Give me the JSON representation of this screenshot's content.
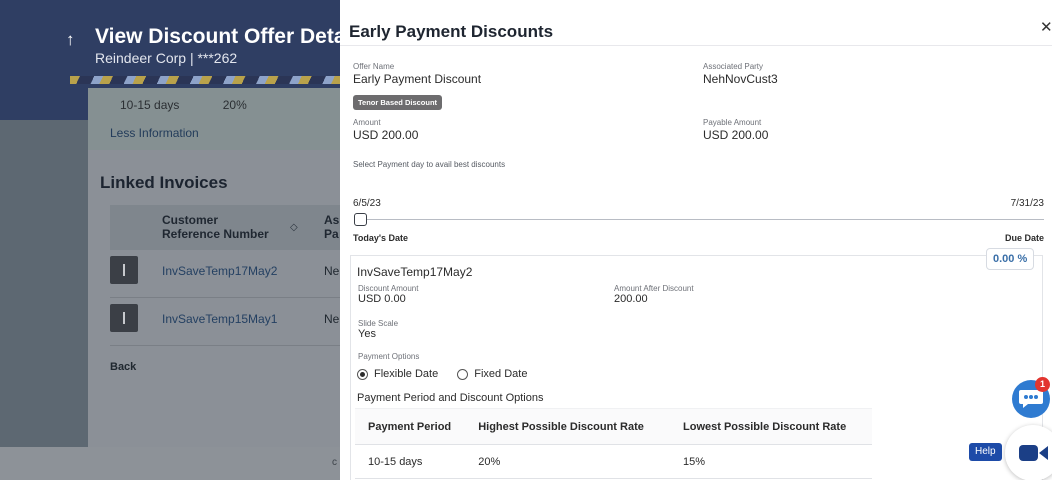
{
  "background": {
    "title": "View Discount Offer Details",
    "subtitle": "Reindeer Corp | ***262",
    "tenor_row": {
      "period": "10-15 days",
      "rate": "20%"
    },
    "less_information": "Less Information",
    "linked_invoices": {
      "title": "Linked Invoices",
      "col_customer_ref": "Customer Reference Number",
      "col_associated_party": "As Pa",
      "rows": [
        {
          "ref": "InvSaveTemp17May2",
          "party": "Ne"
        },
        {
          "ref": "InvSaveTemp15May1",
          "party": "Ne"
        }
      ]
    },
    "back": "Back",
    "footer_fragment": "c"
  },
  "drawer": {
    "title": "Early Payment Discounts",
    "close_icon": "close-icon",
    "offer_name_label": "Offer Name",
    "offer_name": "Early Payment Discount",
    "associated_party_label": "Associated Party",
    "associated_party": "NehNovCust3",
    "badge": "Tenor Based Discount",
    "amount_label": "Amount",
    "amount": "USD 200.00",
    "payable_amount_label": "Payable Amount",
    "payable_amount": "USD 200.00",
    "slider_hint": "Select Payment day to avail best discounts",
    "slider": {
      "start_date": "6/5/23",
      "end_date": "7/31/23",
      "left_label": "Today's Date",
      "right_label": "Due Date",
      "position_fraction": 0.0
    },
    "invoice": {
      "name": "InvSaveTemp17May2",
      "rate": "0.00 %",
      "discount_amount_label": "Discount Amount",
      "discount_amount": "USD 0.00",
      "amount_after_discount_label": "Amount After Discount",
      "amount_after_discount": "200.00",
      "slide_scale_label": "Slide Scale",
      "slide_scale": "Yes",
      "payment_options_label": "Payment Options",
      "options": [
        {
          "label": "Flexible Date",
          "checked": true
        },
        {
          "label": "Fixed Date",
          "checked": false
        }
      ],
      "period_heading": "Payment Period and Discount Options",
      "table_headers": [
        "Payment Period",
        "Highest Possible Discount Rate",
        "Lowest Possible Discount Rate"
      ],
      "table_rows": [
        [
          "10-15 days",
          "20%",
          "15%"
        ]
      ]
    }
  },
  "widgets": {
    "chat_icon": "chat-bubble-icon",
    "chat_badge_count": "1",
    "help_label": "Help",
    "video_icon": "video-camera-icon",
    "colors": {
      "chat": "#2f7bd1",
      "badge": "#e2352f",
      "help": "#1d4ba8",
      "video": "#1b3f86"
    }
  }
}
